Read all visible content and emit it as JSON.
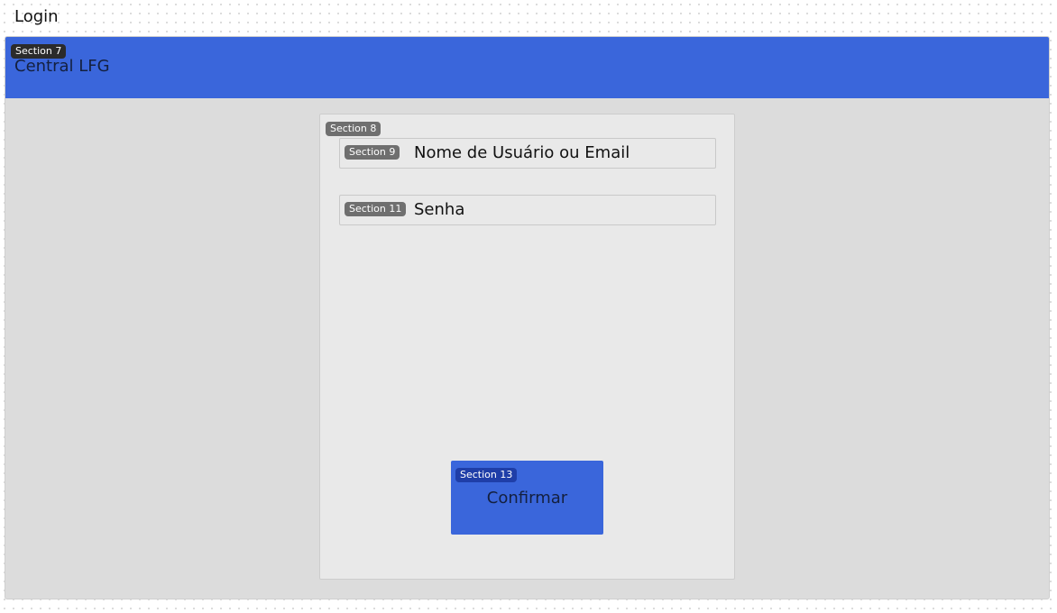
{
  "page": {
    "title": "Login"
  },
  "header": {
    "section_badge": "Section 7",
    "title": "Central LFG",
    "color": "#3a66db"
  },
  "login_card": {
    "section_badge": "Section 8",
    "username_field": {
      "section_badge": "Section 9",
      "placeholder": "Nome de Usuário ou Email"
    },
    "password_field": {
      "section_badge": "Section 11",
      "placeholder": "Senha"
    },
    "confirm_button": {
      "section_badge": "Section 13",
      "label": "Confirmar",
      "color": "#3a66db"
    }
  }
}
